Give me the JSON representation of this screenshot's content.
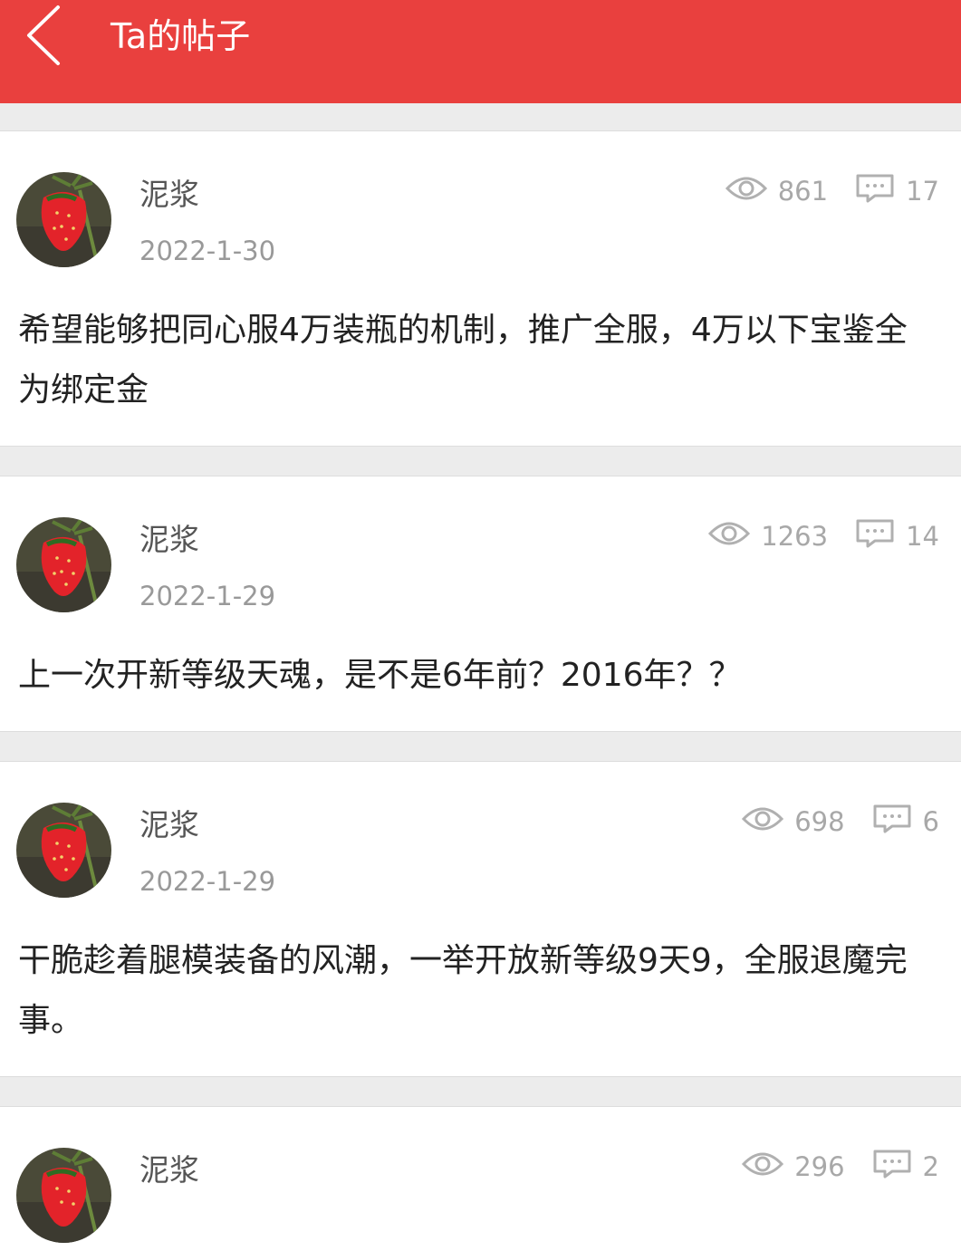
{
  "header": {
    "title": "Ta的帖子",
    "background_color": "#e9403e"
  },
  "posts": [
    {
      "author": "泥浆",
      "date": "2022-1-30",
      "views": "861",
      "comments": "17",
      "content": "希望能够把同心服4万装瓶的机制，推广全服，4万以下宝鉴全为绑定金"
    },
    {
      "author": "泥浆",
      "date": "2022-1-29",
      "views": "1263",
      "comments": "14",
      "content": "上一次开新等级天魂，是不是6年前？2016年？？"
    },
    {
      "author": "泥浆",
      "date": "2022-1-29",
      "views": "698",
      "comments": "6",
      "content": "干脆趁着腿模装备的风潮，一举开放新等级9天9，全服退魔完事。"
    },
    {
      "author": "泥浆",
      "date": "",
      "views": "296",
      "comments": "2",
      "content": ""
    }
  ],
  "icons": {
    "back": "chevron-left-icon",
    "views": "eye-icon",
    "comments": "comment-bubble-icon",
    "avatar": "strawberry-avatar"
  }
}
